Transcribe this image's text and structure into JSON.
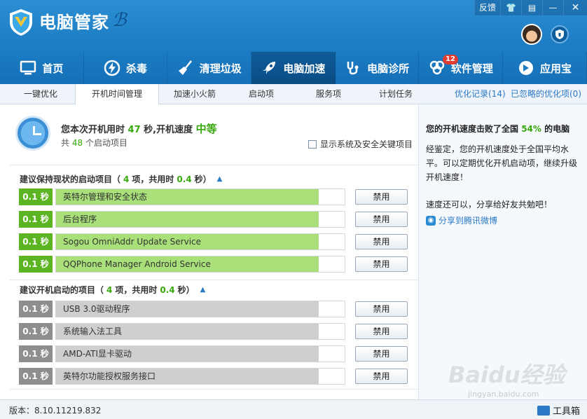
{
  "header": {
    "app_title": "电脑管家",
    "window_controls": [
      "反馈",
      "skin-icon",
      "menu-icon",
      "minimize-icon",
      "close-icon"
    ],
    "feedback_label": "反馈"
  },
  "nav": {
    "items": [
      {
        "label": "首页",
        "icon": "monitor-icon"
      },
      {
        "label": "杀毒",
        "icon": "lightning-icon"
      },
      {
        "label": "清理垃圾",
        "icon": "broom-icon"
      },
      {
        "label": "电脑加速",
        "icon": "rocket-icon",
        "active": true
      },
      {
        "label": "电脑诊所",
        "icon": "stethoscope-icon"
      },
      {
        "label": "软件管理",
        "icon": "software-icon",
        "badge": "12"
      },
      {
        "label": "应用宝",
        "icon": "appstore-icon"
      }
    ]
  },
  "subtabs": {
    "items": [
      "一键优化",
      "开机时间管理",
      "加速小火箭",
      "启动项",
      "服务项",
      "计划任务"
    ],
    "active": "开机时间管理",
    "links": [
      "优化记录(14)",
      "已忽略的优化项(0)"
    ]
  },
  "summary": {
    "prefix": "您本次开机用时",
    "seconds": "47",
    "mid": "秒,开机速度",
    "speed": "中等",
    "count_prefix": "共",
    "count": "48",
    "count_suffix": "个启动项目",
    "checkbox_label": "显示系统及安全关键项目"
  },
  "section_keep": {
    "title_prefix": "建议保持现状的启动项目（",
    "count": "4",
    "mid": "项，共用时",
    "time": "0.4",
    "suffix": "秒）"
  },
  "section_disable": {
    "title_prefix": "建议开机启动的项目（",
    "count": "4",
    "mid": "项，共用时",
    "time": "0.4",
    "suffix": "秒）"
  },
  "keep_items": [
    {
      "time": "0.1 秒",
      "name": "英特尔管理和安全状态",
      "button": "禁用",
      "fill": 0.91
    },
    {
      "time": "0.1 秒",
      "name": "后台程序",
      "button": "禁用",
      "fill": 0.91
    },
    {
      "time": "0.1 秒",
      "name": "Sogou OmniAddr Update Service",
      "button": "禁用",
      "fill": 0.91
    },
    {
      "time": "0.1 秒",
      "name": "QQPhone Manager Android Service",
      "button": "禁用",
      "fill": 0.91
    }
  ],
  "disable_items": [
    {
      "time": "0.1 秒",
      "name": "USB 3.0驱动程序",
      "button": "禁用",
      "fill": 0.91
    },
    {
      "time": "0.1 秒",
      "name": "系统输入法工具",
      "button": "禁用",
      "fill": 0.91
    },
    {
      "time": "0.1 秒",
      "name": "AMD-ATI显卡驱动",
      "button": "禁用",
      "fill": 0.91
    },
    {
      "time": "0.1 秒",
      "name": "英特尔功能授权服务接口",
      "button": "禁用",
      "fill": 0.91
    }
  ],
  "side": {
    "head_prefix": "您的开机速度击败了全国",
    "percent": "54%",
    "head_suffix": "的电脑",
    "desc": "经鉴定，您的开机速度处于全国平均水平。可以定期优化开机启动项，继续升级开机速度！",
    "share_text": "速度还可以，分享给好友共勉吧！",
    "share_link": "分享到腾讯微博"
  },
  "footer": {
    "version": "版本：8.10.11219.832",
    "toolbox": "工具箱"
  },
  "watermark": {
    "main": "Baidu经验",
    "sub": "jingyan.baidu.com"
  },
  "colors": {
    "header_blue": "#1c7dc4",
    "active_nav": "#0b4d84",
    "green_accent": "#37a80c",
    "bar_green": "#a9e07a",
    "bar_gray": "#cfcfcf",
    "link_blue": "#2a79c6"
  }
}
